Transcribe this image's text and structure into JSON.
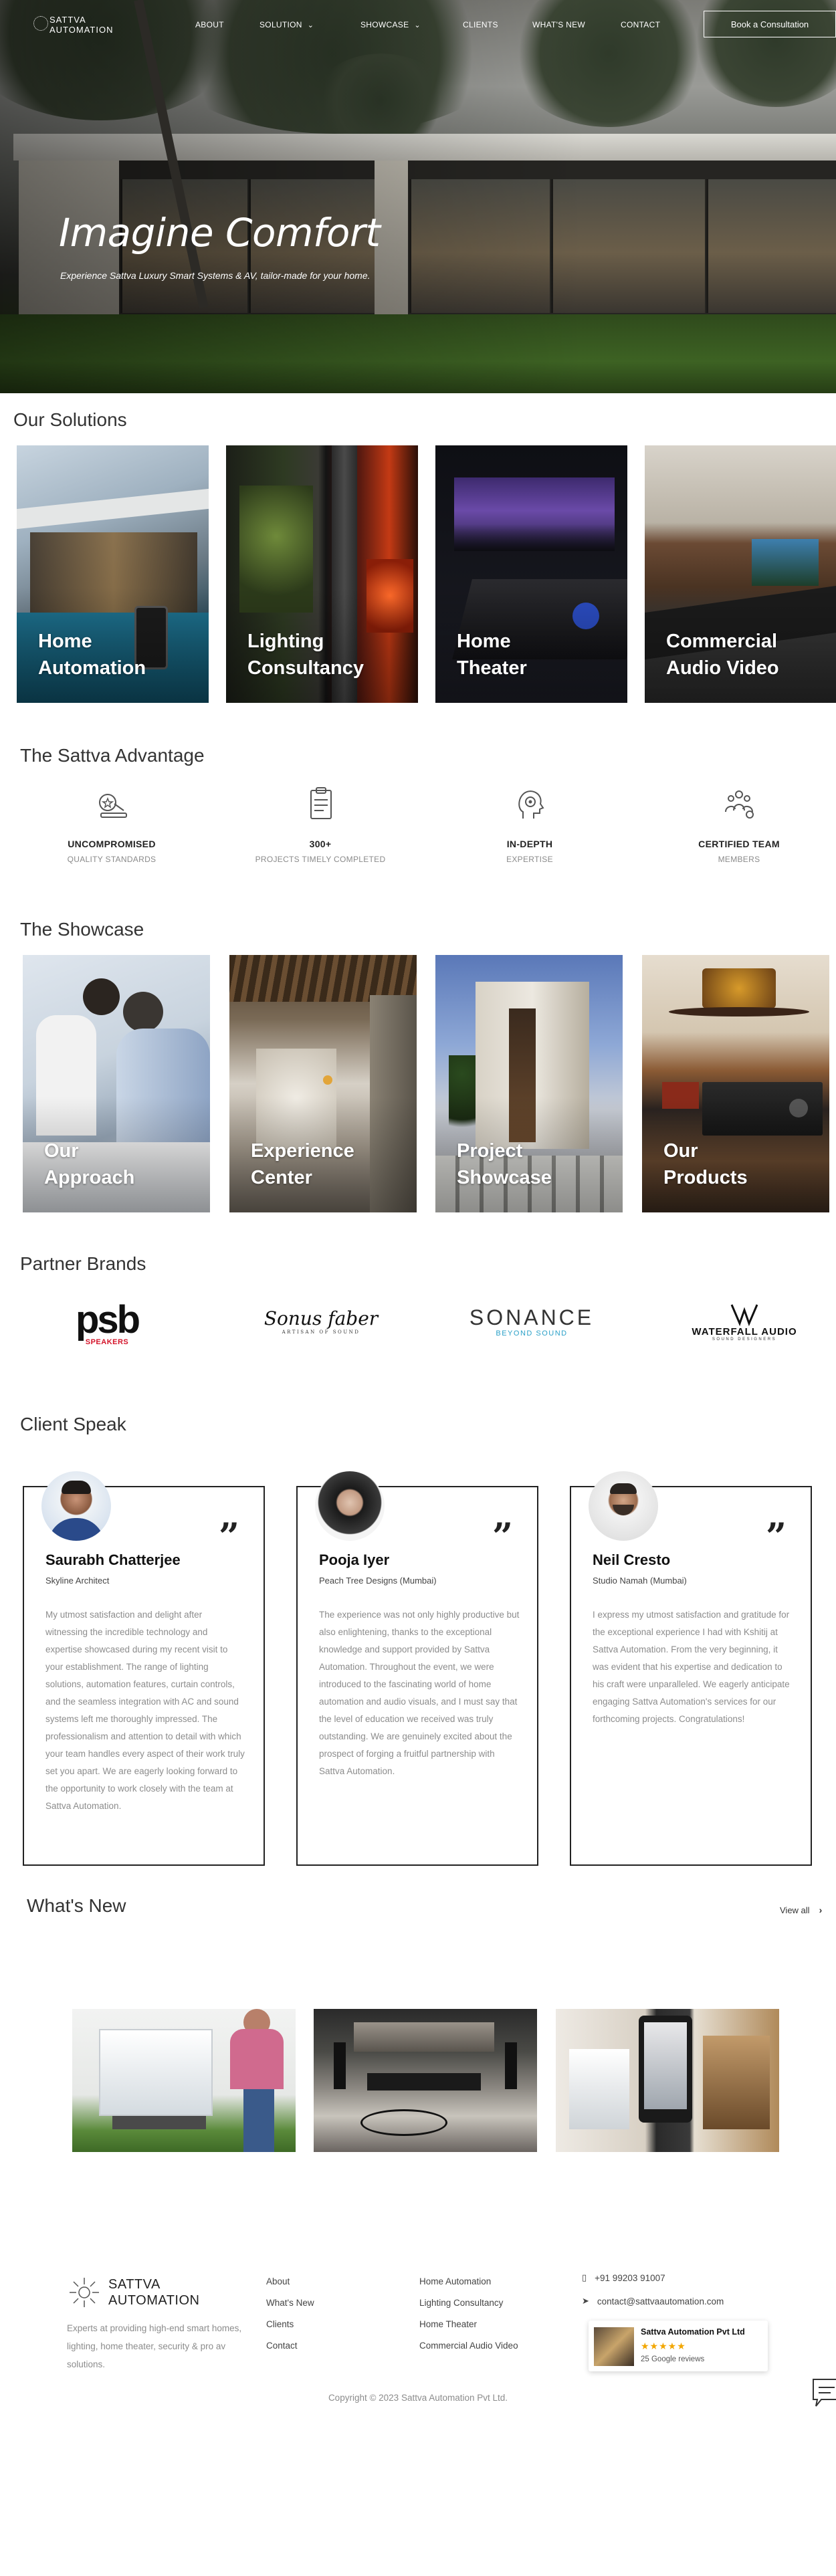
{
  "nav": {
    "logo_line1": "SATTVA",
    "logo_line2": "AUTOMATION",
    "items": [
      {
        "label": "ABOUT"
      },
      {
        "label": "SOLUTION"
      },
      {
        "label": "SHOWCASE"
      },
      {
        "label": "CLIENTS"
      },
      {
        "label": "WHAT'S NEW"
      },
      {
        "label": "CONTACT"
      }
    ],
    "cta_label": "Book a Consultation"
  },
  "hero": {
    "title": "Imagine Comfort",
    "subtitle": "Experience Sattva Luxury Smart Systems & AV, tailor-made for your home."
  },
  "solutions": {
    "heading": "Our Solutions",
    "cards": [
      {
        "line1": "Home",
        "line2": "Automation"
      },
      {
        "line1": "Lighting",
        "line2": "Consultancy"
      },
      {
        "line1": "Home",
        "line2": "Theater"
      },
      {
        "line1": "Commercial",
        "line2": "Audio Video"
      }
    ]
  },
  "advantage": {
    "heading": "The Sattva Advantage",
    "items": [
      {
        "title": "UNCOMPROMISED",
        "subtitle": "QUALITY STANDARDS",
        "icon": "quality-icon"
      },
      {
        "title": "300+",
        "subtitle": "PROJECTS TIMELY COMPLETED",
        "icon": "clipboard-icon"
      },
      {
        "title": "IN-DEPTH",
        "subtitle": "EXPERTISE",
        "icon": "head-gear-icon"
      },
      {
        "title": "CERTIFIED TEAM",
        "subtitle": "MEMBERS",
        "icon": "team-icon"
      }
    ]
  },
  "showcase": {
    "heading": "The Showcase",
    "cards": [
      {
        "line1": "Our",
        "line2": "Approach"
      },
      {
        "line1": "Experience",
        "line2": "Center"
      },
      {
        "line1": "Project",
        "line2": "Showcase"
      },
      {
        "line1": "Our",
        "line2": "Products"
      }
    ]
  },
  "partners": {
    "heading": "Partner Brands",
    "brands": [
      {
        "main": "psb",
        "sub": "SPEAKERS"
      },
      {
        "main": "Sonus faber",
        "sub": "ARTISAN OF SOUND"
      },
      {
        "main": "SONANCE",
        "sub": "BEYOND SOUND"
      },
      {
        "main": "WATERFALL AUDIO",
        "sub": "SOUND DESIGNERS"
      }
    ]
  },
  "clients": {
    "heading": "Client Speak",
    "testimonials": [
      {
        "name": "Saurabh Chatterjee",
        "role": "Skyline Architect",
        "text": "My utmost satisfaction and delight after witnessing the incredible technology and expertise showcased during my recent visit to your establishment. The range of lighting solutions, automation features, curtain controls, and the seamless integration with AC and sound systems left me thoroughly impressed. The professionalism and attention to detail with which your team handles every aspect of their work truly set you apart. We are eagerly looking forward to the opportunity to work closely with the team at Sattva Automation."
      },
      {
        "name": "Pooja Iyer",
        "role": "Peach Tree Designs (Mumbai)",
        "text": "The experience was not only highly productive but also enlightening, thanks to the exceptional knowledge and support provided by Sattva Automation. Throughout the event, we were introduced to the fascinating world of home automation and audio visuals, and I must say that the level of education we received was truly outstanding. We are genuinely excited about the prospect of forging a fruitful partnership with Sattva Automation."
      },
      {
        "name": "Neil Cresto",
        "role": "Studio Namah (Mumbai)",
        "text": "I express my utmost satisfaction and gratitude for the exceptional experience I had with Kshitij at Sattva Automation. From the very beginning, it was evident that his expertise and dedication to his craft were unparalleled. We eagerly anticipate engaging Sattva Automation's services for our forthcoming projects. Congratulations!"
      }
    ]
  },
  "whats_new": {
    "heading": "What's New",
    "view_all": "View all"
  },
  "footer": {
    "logo_line1": "SATTVA",
    "logo_line2": "AUTOMATION",
    "description": "Experts at providing high-end smart homes, lighting, home theater, security & pro av solutions.",
    "col1": [
      "About",
      "What's New",
      "Clients",
      "Contact"
    ],
    "col2": [
      "Home Automation",
      "Lighting Consultancy",
      "Home Theater",
      "Commercial Audio Video"
    ],
    "phone": "+91 99203 91007",
    "email": "contact@sattvaautomation.com",
    "google_card": {
      "company": "Sattva Automation Pvt Ltd",
      "reviews": "25 Google reviews"
    },
    "copyright": "Copyright © 2023 Sattva Automation Pvt Ltd."
  }
}
